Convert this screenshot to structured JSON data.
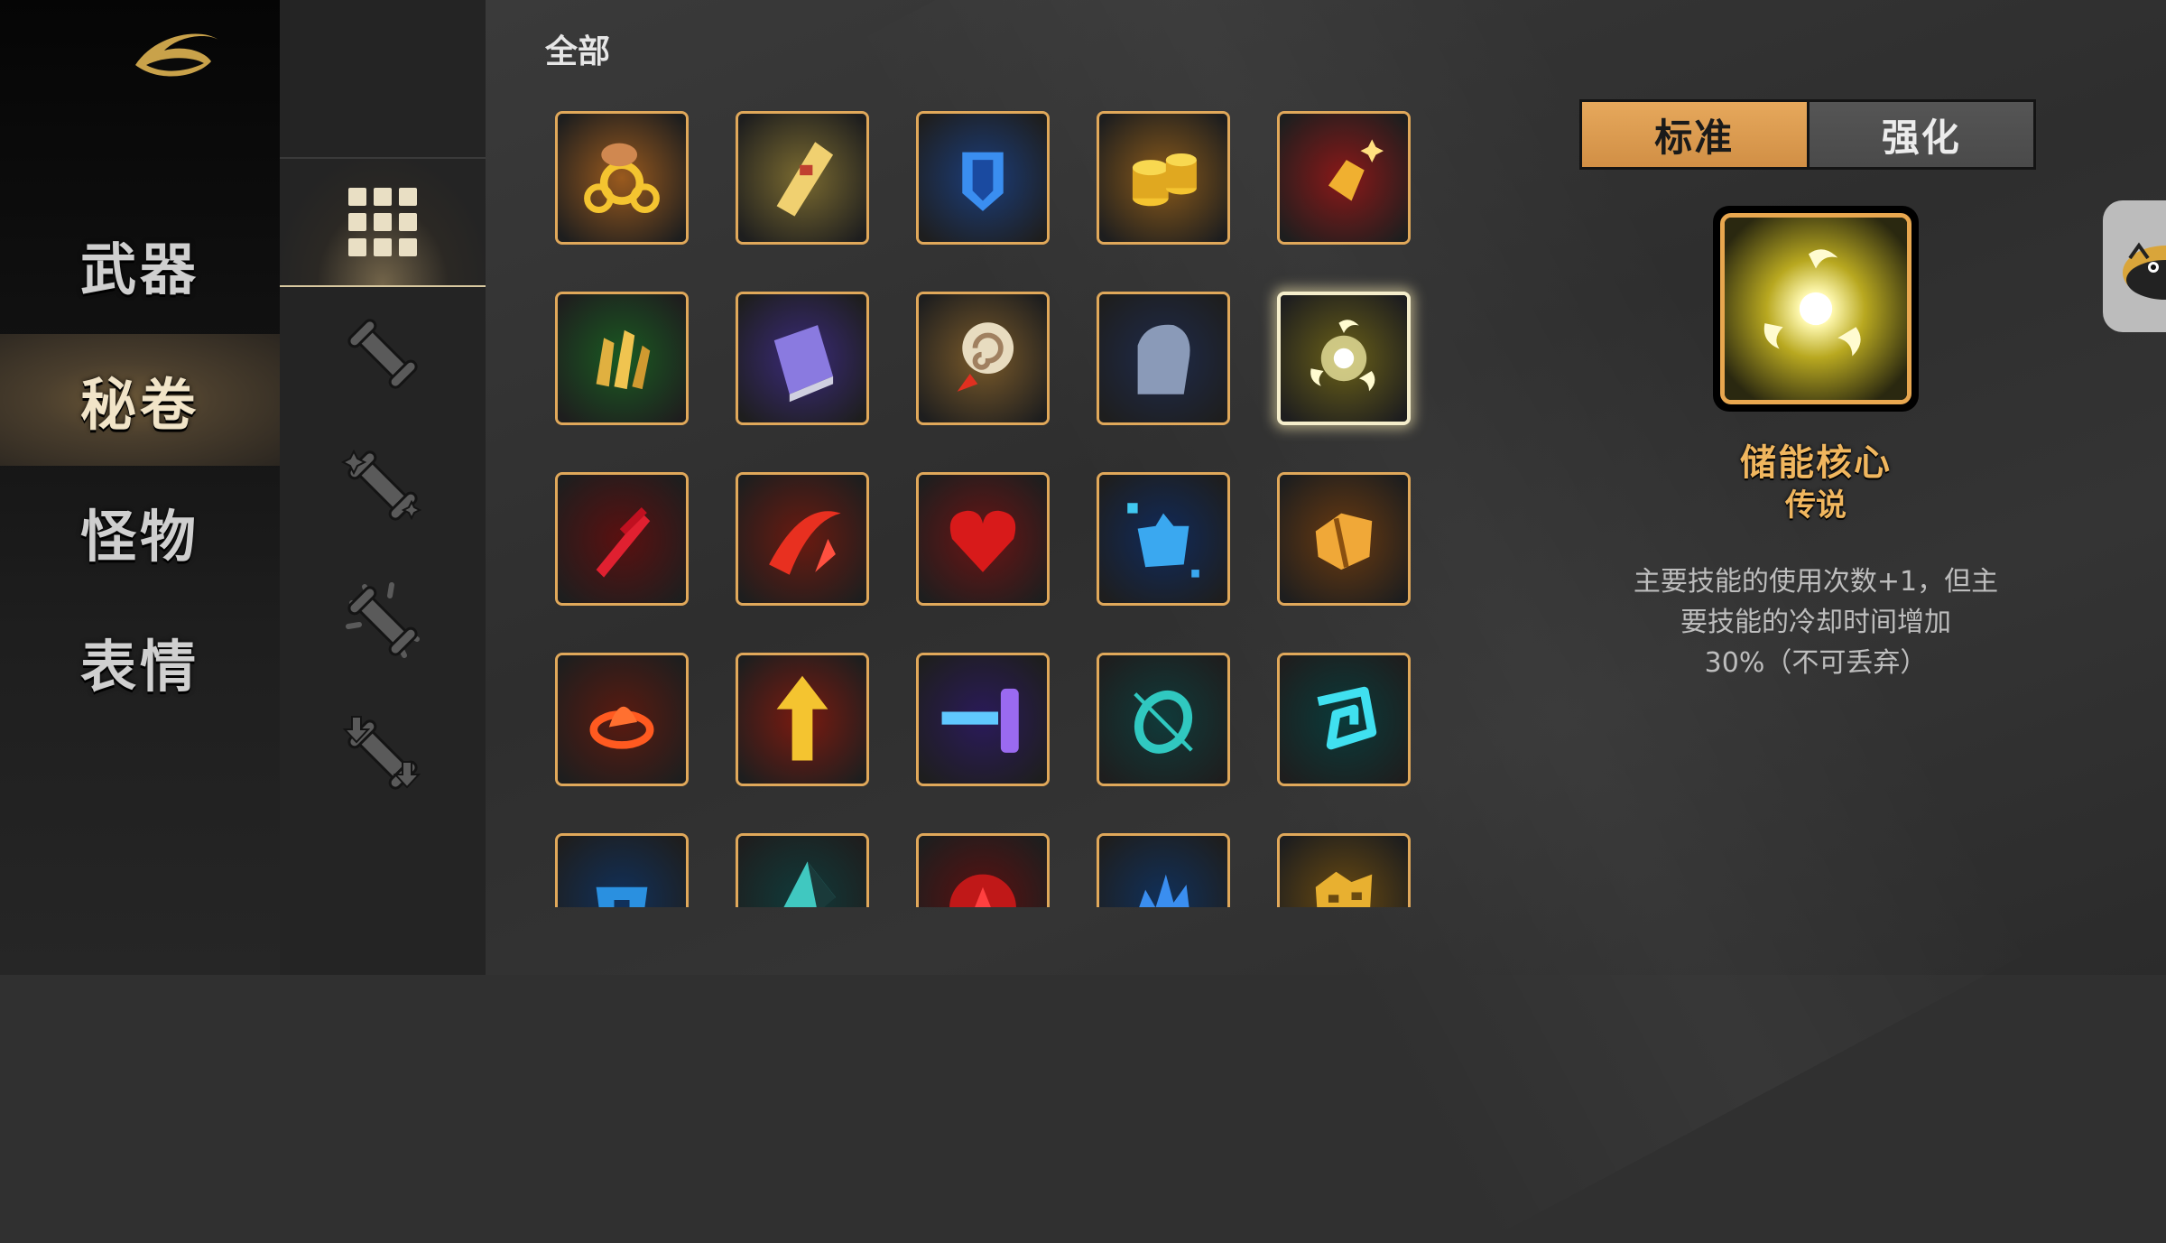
{
  "nav": {
    "items": [
      {
        "label": "武器"
      },
      {
        "label": "秘卷"
      },
      {
        "label": "怪物"
      },
      {
        "label": "表情"
      }
    ],
    "active_index": 1
  },
  "categories": {
    "icons": [
      "grid-all-icon",
      "scroll-icon",
      "scroll-sparkle-icon",
      "scroll-burst-icon",
      "scroll-arrows-icon"
    ],
    "active_index": 0
  },
  "section": {
    "title": "全部"
  },
  "grid": {
    "tiles": [
      {
        "icon": "gold-rings-icon",
        "theme": "#9a5a1e"
      },
      {
        "icon": "golden-scroll-icon",
        "theme": "#7a6a30"
      },
      {
        "icon": "blue-crystal-shield-icon",
        "theme": "#1b3d7a"
      },
      {
        "icon": "gold-coins-stack-icon",
        "theme": "#8a5a1a"
      },
      {
        "icon": "gold-gem-icon",
        "theme": "#8a1818"
      },
      {
        "icon": "green-crystal-icon",
        "theme": "#1a5a22"
      },
      {
        "icon": "purple-book-icon",
        "theme": "#3a2a7a"
      },
      {
        "icon": "swirl-orb-staff-icon",
        "theme": "#7a5a2a"
      },
      {
        "icon": "stone-head-icon",
        "theme": "#1e2a4a"
      },
      {
        "icon": "energy-core-icon",
        "theme": "#6a6018",
        "selected": true
      },
      {
        "icon": "red-sword-icon",
        "theme": "#5a1010"
      },
      {
        "icon": "red-slash-icon",
        "theme": "#6a1a10"
      },
      {
        "icon": "red-heart-icon",
        "theme": "#6a1414"
      },
      {
        "icon": "blue-shard-icon",
        "theme": "#102a5a"
      },
      {
        "icon": "gold-armor-icon",
        "theme": "#6a3a10"
      },
      {
        "icon": "fire-ring-icon",
        "theme": "#5a1a10"
      },
      {
        "icon": "gold-arrow-icon",
        "theme": "#7a1a10"
      },
      {
        "icon": "purple-portal-icon",
        "theme": "#2a1a5a"
      },
      {
        "icon": "teal-ring-icon",
        "theme": "#103a3a"
      },
      {
        "icon": "teal-rune-icon",
        "theme": "#0a3a3a"
      },
      {
        "icon": "blue-helmet-icon",
        "theme": "#10305a"
      },
      {
        "icon": "teal-blade-icon",
        "theme": "#103a3a"
      },
      {
        "icon": "red-orb-icon",
        "theme": "#5a1010"
      },
      {
        "icon": "blue-claw-icon",
        "theme": "#10305a"
      },
      {
        "icon": "gold-mask-icon",
        "theme": "#6a4a10"
      }
    ]
  },
  "detail": {
    "tabs": [
      {
        "label": "标准"
      },
      {
        "label": "强化"
      }
    ],
    "active_tab": 0,
    "icon": "energy-core-icon",
    "name": "储能核心",
    "rarity": "传说",
    "desc_lines": [
      "主要技能的使用次数+1，但主",
      "要技能的冷却时间增加",
      "30%（不可丢弃）"
    ]
  },
  "side_button": {
    "icon": "bee-avatar-icon"
  },
  "colors": {
    "accent": "#e0a85a",
    "rarity_text": "#f0b65e",
    "toggle_on": "#e6a85c",
    "toggle_off": "#4e4e4e"
  }
}
